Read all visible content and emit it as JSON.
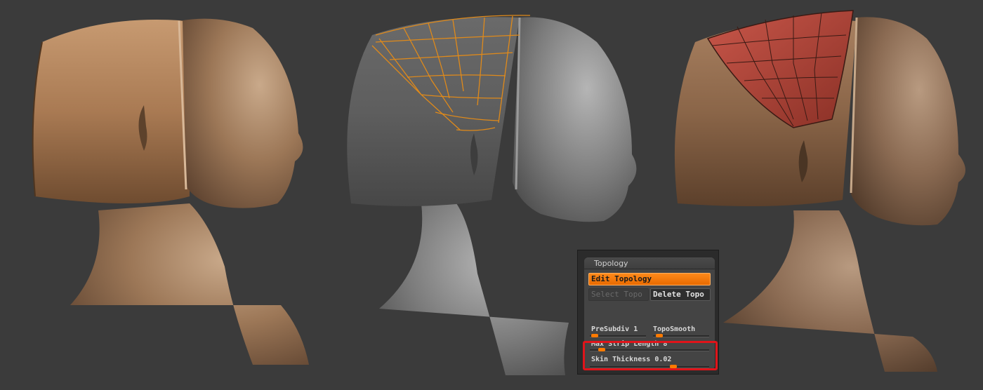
{
  "panel": {
    "title": "Topology",
    "edit_topology_label": "Edit Topology",
    "select_topo_label": "Select Topo",
    "delete_topo_label": "Delete Topo",
    "presubdiv": {
      "label": "PreSubdiv",
      "value": "1",
      "level": 0.12
    },
    "toposmooth": {
      "label": "TopoSmooth",
      "value": "",
      "level": 0.15
    },
    "max_strip_length": {
      "label": "Max Strip Length",
      "value": "8",
      "level": 0.15
    },
    "skin_thickness": {
      "label": "Skin Thickness",
      "value": "0.02",
      "level": 0.72
    }
  },
  "colors": {
    "accent": "#ff7a00",
    "highlight": "#e0141a",
    "background": "#3b3b3b"
  }
}
